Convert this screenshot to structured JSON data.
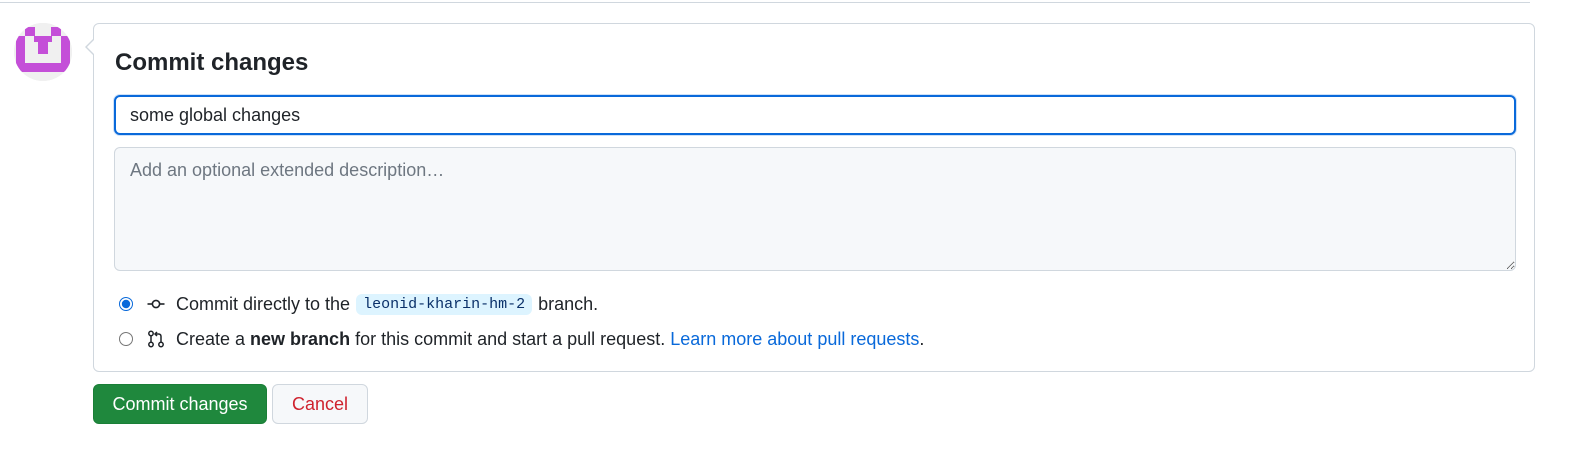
{
  "avatar": {
    "color": "#c44fd8",
    "background": "#f0f0f0"
  },
  "commit_form": {
    "title": "Commit changes",
    "summary_value": "some global changes",
    "description_placeholder": "Add an optional extended description…",
    "option_direct": {
      "selected": true,
      "text_before": "Commit directly to the",
      "branch": "leonid-kharin-hm-2",
      "text_after": "branch.",
      "icon": "git-commit-icon"
    },
    "option_new_branch": {
      "selected": false,
      "text_before": "Create a",
      "bold_text": "new branch",
      "text_after": "for this commit and start a pull request.",
      "link_text": "Learn more about pull requests",
      "link_suffix": ".",
      "icon": "git-pull-request-icon"
    }
  },
  "buttons": {
    "commit_label": "Commit changes",
    "cancel_label": "Cancel"
  },
  "colors": {
    "primary_button": "#1f883d",
    "danger_text": "#cf222e",
    "link": "#0969da",
    "focus_border": "#0969da"
  }
}
